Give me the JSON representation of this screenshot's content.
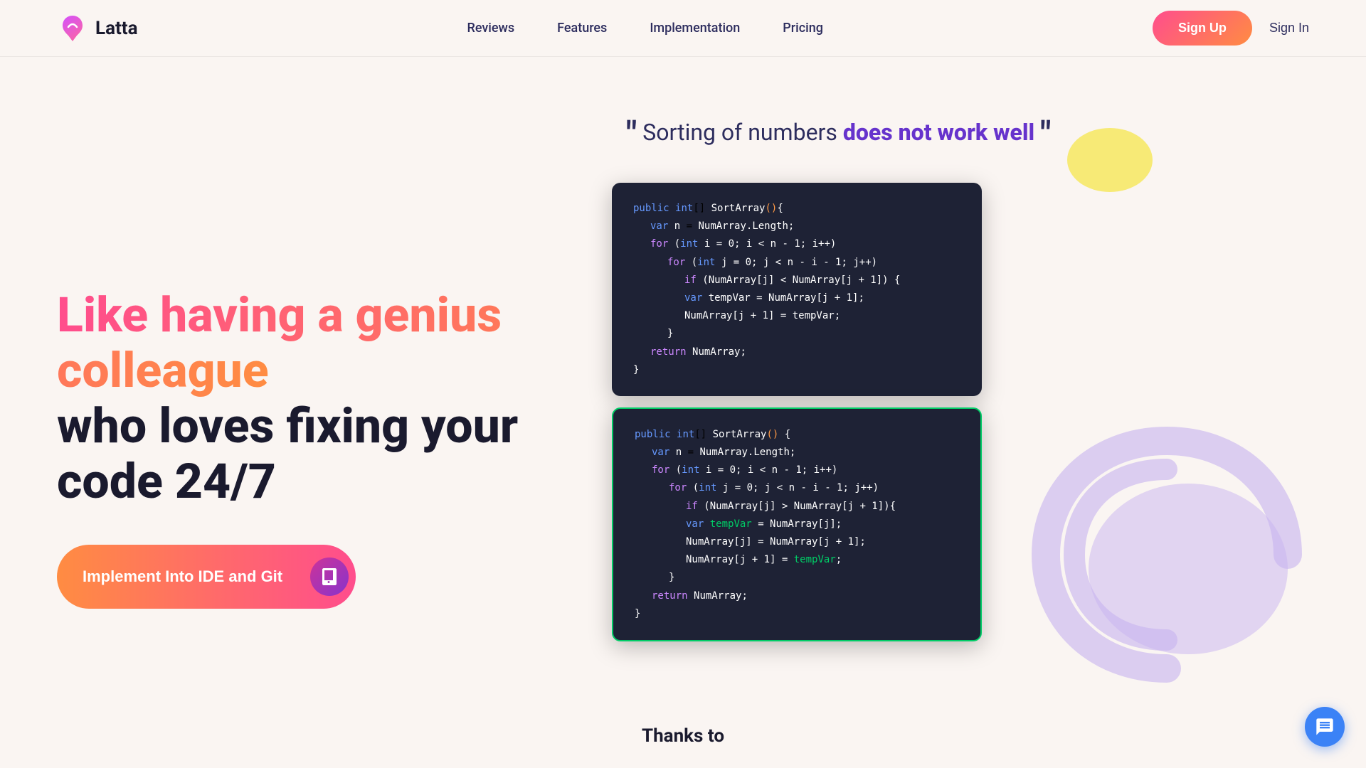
{
  "navbar": {
    "logo_text": "Latta",
    "nav_links": [
      {
        "id": "reviews",
        "label": "Reviews",
        "href": "#"
      },
      {
        "id": "features",
        "label": "Features",
        "href": "#"
      },
      {
        "id": "implementation",
        "label": "Implementation",
        "href": "#"
      },
      {
        "id": "pricing",
        "label": "Pricing",
        "href": "#"
      }
    ],
    "signup_label": "Sign Up",
    "signin_label": "Sign In"
  },
  "hero": {
    "headline_gradient": "Like having a genius colleague",
    "headline_dark": "who loves fixing your code 24/7",
    "implement_button": "Implement Into IDE and Git",
    "quote_start": "\"",
    "quote_normal": "Sorting of numbers ",
    "quote_highlight": "does not work well",
    "quote_end": "\""
  },
  "code_card_1": {
    "lines": [
      "public int[] SortArray(){",
      "    var n = NumArray.Length;",
      "    for (int i = 0; i < n - 1; i++)",
      "        for (int j = 0; j < n - i - 1; j++)",
      "            if (NumArray[j] < NumArray[j + 1]) {",
      "                var tempVar = NumArray[j + 1];",
      "                NumArray[j + 1] = tempVar;",
      "            }",
      "    return NumArray;",
      "}"
    ]
  },
  "code_card_2": {
    "lines": [
      "public int[] SortArray() {",
      "    var n = NumArray.Length;",
      "    for (int i = 0; i < n - 1; i++)",
      "        for (int j = 0; j < n - i - 1; j++)",
      "            if (NumArray[j] > NumArray[j + 1]){",
      "                var tempVar = NumArray[j];",
      "                NumArray[j] = NumArray[j + 1];",
      "                NumArray[j + 1] = tempVar;",
      "            }",
      "    return NumArray;",
      "}"
    ]
  },
  "thanks_section": {
    "label": "Thanks to"
  }
}
